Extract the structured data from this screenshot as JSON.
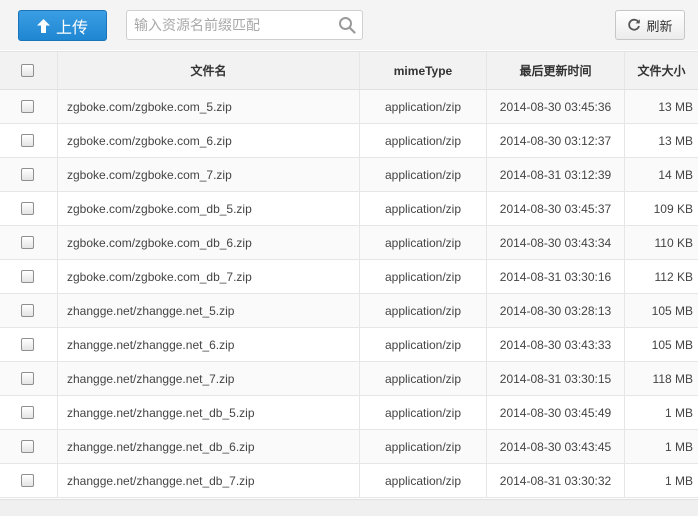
{
  "toolbar": {
    "upload_label": "上传",
    "search_placeholder": "输入资源名前缀匹配",
    "refresh_label": "刷新"
  },
  "table": {
    "headers": {
      "name": "文件名",
      "mime": "mimeType",
      "time": "最后更新时间",
      "size": "文件大小"
    },
    "rows": [
      {
        "name": "zgboke.com/zgboke.com_5.zip",
        "mime": "application/zip",
        "time": "2014-08-30 03:45:36",
        "size": "13 MB"
      },
      {
        "name": "zgboke.com/zgboke.com_6.zip",
        "mime": "application/zip",
        "time": "2014-08-30 03:12:37",
        "size": "13 MB"
      },
      {
        "name": "zgboke.com/zgboke.com_7.zip",
        "mime": "application/zip",
        "time": "2014-08-31 03:12:39",
        "size": "14 MB"
      },
      {
        "name": "zgboke.com/zgboke.com_db_5.zip",
        "mime": "application/zip",
        "time": "2014-08-30 03:45:37",
        "size": "109 KB"
      },
      {
        "name": "zgboke.com/zgboke.com_db_6.zip",
        "mime": "application/zip",
        "time": "2014-08-30 03:43:34",
        "size": "110 KB"
      },
      {
        "name": "zgboke.com/zgboke.com_db_7.zip",
        "mime": "application/zip",
        "time": "2014-08-31 03:30:16",
        "size": "112 KB"
      },
      {
        "name": "zhangge.net/zhangge.net_5.zip",
        "mime": "application/zip",
        "time": "2014-08-30 03:28:13",
        "size": "105 MB"
      },
      {
        "name": "zhangge.net/zhangge.net_6.zip",
        "mime": "application/zip",
        "time": "2014-08-30 03:43:33",
        "size": "105 MB"
      },
      {
        "name": "zhangge.net/zhangge.net_7.zip",
        "mime": "application/zip",
        "time": "2014-08-31 03:30:15",
        "size": "118 MB"
      },
      {
        "name": "zhangge.net/zhangge.net_db_5.zip",
        "mime": "application/zip",
        "time": "2014-08-30 03:45:49",
        "size": "1 MB"
      },
      {
        "name": "zhangge.net/zhangge.net_db_6.zip",
        "mime": "application/zip",
        "time": "2014-08-30 03:43:45",
        "size": "1 MB"
      },
      {
        "name": "zhangge.net/zhangge.net_db_7.zip",
        "mime": "application/zip",
        "time": "2014-08-31 03:30:32",
        "size": "1 MB"
      }
    ]
  },
  "icons": {
    "upload": "arrow-up-icon",
    "search": "magnifier-icon",
    "refresh": "refresh-icon",
    "checkbox": "checkbox-unchecked"
  },
  "colors": {
    "upload_button": "#1f86d2",
    "header_background": "#f2f2f2",
    "text": "#444444"
  }
}
